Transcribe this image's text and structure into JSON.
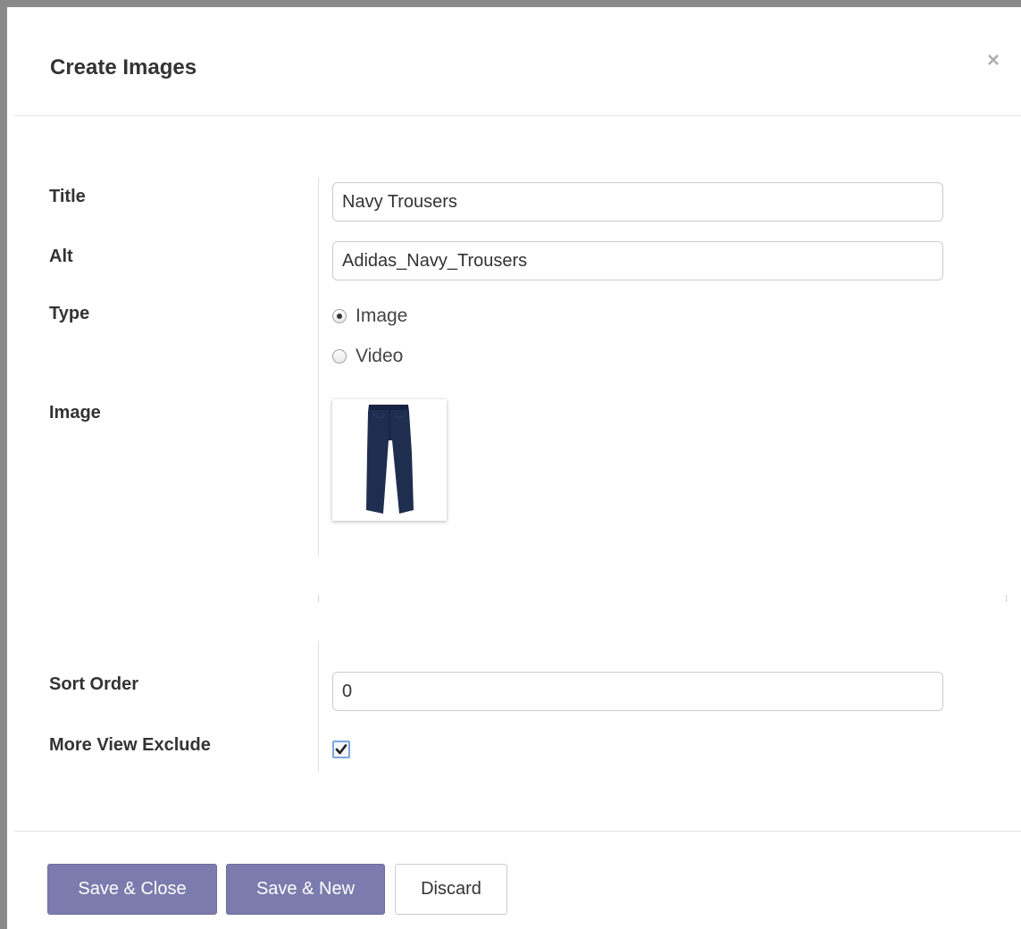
{
  "dialog": {
    "title": "Create Images",
    "close_icon": "×"
  },
  "form": {
    "title": {
      "label": "Title",
      "value": "Navy Trousers"
    },
    "alt": {
      "label": "Alt",
      "value": "Adidas_Navy_Trousers"
    },
    "type": {
      "label": "Type",
      "options": [
        {
          "label": "Image",
          "selected": true
        },
        {
          "label": "Video",
          "selected": false
        }
      ]
    },
    "image": {
      "label": "Image",
      "thumbnail": "navy-trousers-thumbnail"
    },
    "sort_order": {
      "label": "Sort Order",
      "value": "0"
    },
    "more_view_exclude": {
      "label": "More View Exclude",
      "checked": true
    }
  },
  "footer": {
    "save_close": "Save & Close",
    "save_new": "Save & New",
    "discard": "Discard"
  },
  "colors": {
    "primary": "#7c7bad",
    "trousers": "#1f2d4f"
  }
}
